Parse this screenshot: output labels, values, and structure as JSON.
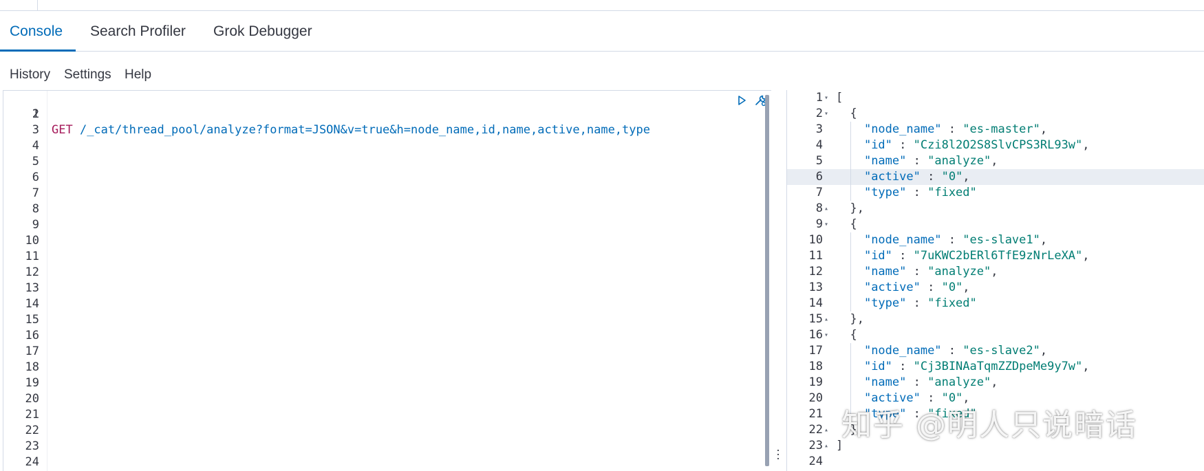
{
  "tabs": [
    {
      "label": "Console",
      "active": true
    },
    {
      "label": "Search Profiler",
      "active": false
    },
    {
      "label": "Grok Debugger",
      "active": false
    }
  ],
  "menu": [
    "History",
    "Settings",
    "Help"
  ],
  "request": {
    "method": "GET",
    "url": " /_cat/thread_pool/analyze?format=JSON&v=true&h=node_name,id,name,active,name,type",
    "line_count": 24
  },
  "icons": {
    "run": "play-icon",
    "settings": "wrench-icon",
    "resizer": "vertical-dots-icon"
  },
  "response": {
    "lines": [
      "[",
      "  {",
      "    \"node_name\" : \"es-master\",",
      "    \"id\" : \"Czi8l2O2S8SlvCPS3RL93w\",",
      "    \"name\" : \"analyze\",",
      "    \"active\" : \"0\",",
      "    \"type\" : \"fixed\"",
      "  },",
      "  {",
      "    \"node_name\" : \"es-slave1\",",
      "    \"id\" : \"7uKWC2bERl6TfE9zNrLeXA\",",
      "    \"name\" : \"analyze\",",
      "    \"active\" : \"0\",",
      "    \"type\" : \"fixed\"",
      "  },",
      "  {",
      "    \"node_name\" : \"es-slave2\",",
      "    \"id\" : \"Cj3BINAaTqmZZDpeMe9y7w\",",
      "    \"name\" : \"analyze\",",
      "    \"active\" : \"0\",",
      "    \"type\" : \"fixed\"",
      "  }",
      "]",
      ""
    ],
    "folds": {
      "1": "open",
      "2": "open",
      "8": "close",
      "9": "open",
      "15": "close",
      "16": "open",
      "22": "close",
      "23": "close"
    },
    "highlighted_line": 6
  },
  "watermark": "知乎 @明人只说暗话",
  "colors": {
    "accent": "#006bb8",
    "method": "#a51a5a",
    "string": "#017d73"
  }
}
